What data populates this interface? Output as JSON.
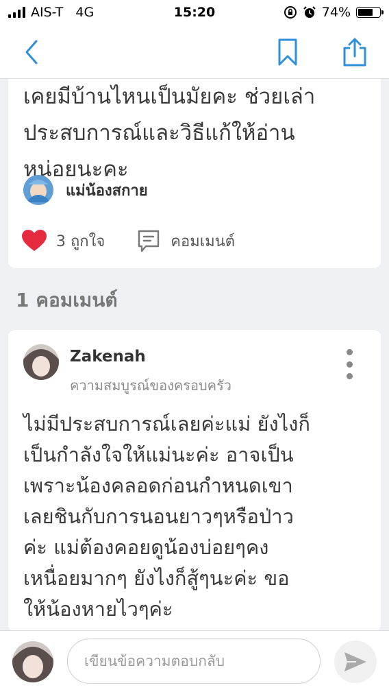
{
  "status_bar": {
    "carrier": "AIS-T",
    "network": "4G",
    "time": "15:20",
    "battery_percent": "74%",
    "battery_level": 0.74,
    "icons": [
      "signal-bars-icon",
      "orientation-lock-icon",
      "alarm-icon",
      "battery-icon"
    ]
  },
  "nav": {
    "icons": [
      "back-chevron-icon",
      "bookmark-icon",
      "share-icon"
    ],
    "accent_color": "#2f8fd8"
  },
  "post": {
    "text": "เคยมีบ้านไหนเป็นมัยคะ ช่วยเล่า\nประสบการณ์และวิธีแก้ให้อ่าน\nหน่อยนะคะ",
    "author": "แม่น้องสกาย",
    "likes_label": "3 ถูกใจ",
    "comment_label": "คอมเมนต์",
    "like_color": "#e5293f"
  },
  "comments_count_label": "1 คอมเมนต์",
  "comment": {
    "author": "Zakenah",
    "subtitle": "ความสมบูรณ์ของครอบครัว",
    "text": "ไม่มีประสบการณ์เลยค่ะแม่  ยังไงก็\nเป็นกำลังใจให้แม่นะค่ะ อาจเป็น\nเพราะน้องคลอดก่อนกำหนดเขา\nเลยชินกับการนอนยาวๆหรือป่าว\nค่ะ แม่ต้องคอยดูน้องบ่อยๆคง\nเหนื่อยมากๆ ยังไงก็สู้ๆนะค่ะ ขอ\nให้น้องหายไวๆค่ะ"
  },
  "reply": {
    "placeholder": "เขียนข้อความตอบกลับ",
    "value": ""
  }
}
